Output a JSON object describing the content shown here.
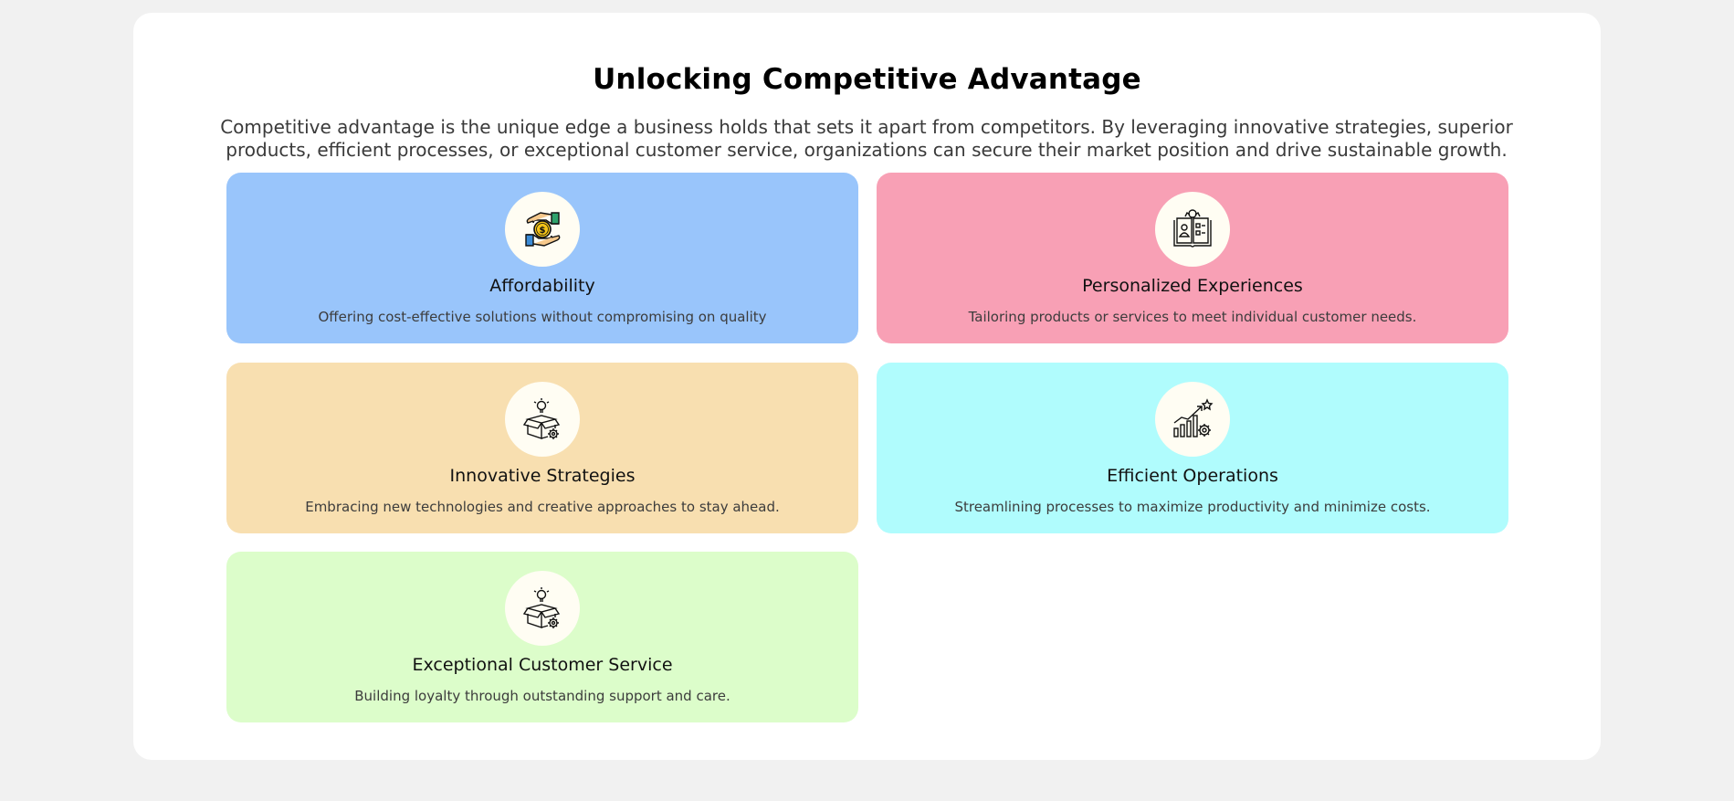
{
  "page": {
    "title": "Unlocking Competitive Advantage",
    "intro": "Competitive advantage is the unique edge a business holds that sets it apart from competitors. By leveraging innovative strategies, superior products, efficient processes, or exceptional customer service, organizations can secure their market position and drive sustainable growth."
  },
  "cards": [
    {
      "title": "Affordability",
      "description": "Offering cost-effective solutions without compromising on quality",
      "icon": "dollar-coin-hand-icon",
      "color": "#99c5fb"
    },
    {
      "title": "Personalized Experiences",
      "description": "Tailoring products or services to meet individual customer needs.",
      "icon": "profile-book-icon",
      "color": "#f8a0b5"
    },
    {
      "title": "Innovative Strategies",
      "description": "Embracing new technologies and creative approaches to stay ahead.",
      "icon": "idea-box-gear-icon",
      "color": "#f8dfb0"
    },
    {
      "title": "Efficient Operations",
      "description": "Streamlining processes to maximize productivity and minimize costs.",
      "icon": "growth-chart-gear-icon",
      "color": "#b0fcfd"
    },
    {
      "title": "Exceptional Customer Service",
      "description": "Building loyalty through outstanding support and care.",
      "icon": "idea-box-gear-icon",
      "color": "#dcfdca"
    }
  ]
}
